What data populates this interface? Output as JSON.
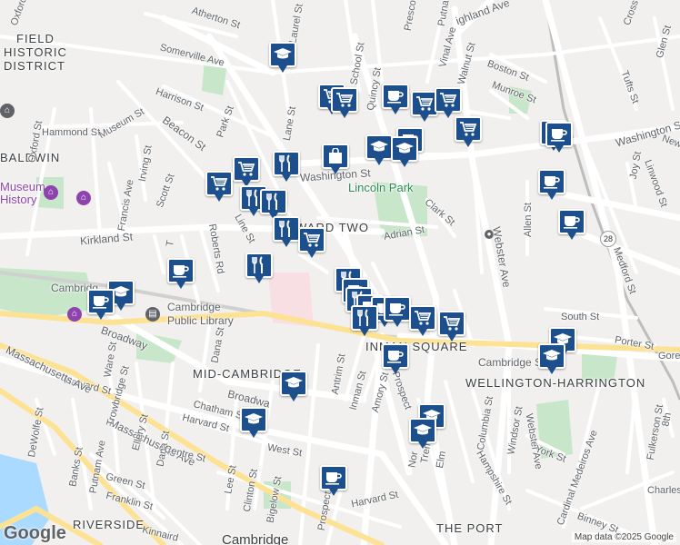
{
  "map": {
    "attribution": "Map data ©2025 Google",
    "logo": "Google",
    "areas": {
      "field": "FIELD",
      "historic": "HISTORIC",
      "district": "DISTRICT",
      "baldwin": "BALDWIN",
      "ward_two": "WARD TWO",
      "inman_square": "INMAN SQUARE",
      "mid_cambridge": "MID-CAMBRIDGE",
      "wellington_harrington": "WELLINGTON-HARRINGTON",
      "riverside": "RIVERSIDE",
      "the_port": "THE PORT",
      "cambridge": "Cambridge"
    },
    "pois": {
      "lincoln_park": "Lincoln Park",
      "museum": "Museum",
      "history": "History",
      "library_1": "Cambridge",
      "library_2": "Public Library"
    },
    "streets": {
      "somerville_ave": "Somerville Ave",
      "atherton_st": "Atherton St",
      "washington_st": "Washington St",
      "washington_st_east": "Washington St",
      "kirkland_st": "Kirkland St",
      "cambridge_st": "Cambridge St",
      "cambridge_st_west": "Cambridg",
      "broadway": "Broadway",
      "broadway_mid": "Broadwa",
      "harvard_st": "Harvard St",
      "harvard_st_2": "Harvard St",
      "harvard_st_3": "Harvard St",
      "massachusetts_ave": "Massachusetts Ave",
      "massachusetts_ave_2": "Massachusetts Ave",
      "beacon_st": "Beacon St",
      "hammond_st": "Hammond St",
      "museum_st": "Museum St",
      "harrison_st": "Harrison St",
      "park_st": "Park St",
      "oxford_st": "Oxford St",
      "oxford_st_2": "Oxford St",
      "francis_ave": "Francis Ave",
      "irving_st": "Irving St",
      "scott_st": "Scott St",
      "line_st": "Line St",
      "adrian_st": "Adrian St",
      "clark_st": "Clark St",
      "webster_ave": "Webster Ave",
      "webster_ave_2": "Webster Ave",
      "allen_st": "Allen St",
      "medford_st": "Medford St",
      "linwood_st": "Linwood St",
      "joy_st": "Joy St",
      "tufts_st": "Tufts St",
      "glen_st": "Glen St",
      "boston_st": "Boston St",
      "munroe_st": "Munroe St",
      "walnut_st": "Walnut St",
      "vinal_ave": "Vinal Ave",
      "putnam_ave": "Putnam",
      "putnam_ave_2": "Putnam Ave",
      "highland_ave": "ighland Ave",
      "prescott_st": "Prescott",
      "quincy_st": "Quincy St",
      "school_st": "School St",
      "laurel_st": "Laurel St",
      "lane_st": "Lane St",
      "south_st": "South St",
      "porter_st": "Porter St",
      "gore_st": "Gore",
      "york_st": "York St",
      "windsor_st": "Windsor St",
      "columbia_st": "Columbia St",
      "hampshire_st": "Hampshire St",
      "amory_st": "Amory St",
      "inman_st": "Inman St",
      "antrim_st": "Antrim St",
      "prospect_st": "Prospect",
      "prospect_st_2": "Prospect St",
      "tremont_st": "Tremont",
      "elm_st": "Elm",
      "norfolk_st": "Nor",
      "dana_st": "Dana St",
      "dana_st_2": "Dana St",
      "chatham_st": "Chatham St",
      "centre_st": "Centre St",
      "west_st": "West St",
      "ellery_st": "Ellery St",
      "trowbridge_st": "Trowbridge St",
      "ware_st": "Ware St",
      "banks_st": "Banks St",
      "dewolfe_st": "DeWolfe St",
      "green_st": "Green St",
      "franklin_st": "Franklin St",
      "kinnaird_st": "Kinnaird",
      "lee_st": "Lee St",
      "clinton_st": "Clinton St",
      "bigelow_st": "Bigelow St",
      "fulkerson_st": "Fulkerson St",
      "charles_st": "Charles",
      "binney_st": "Binney St",
      "cardinal_medeiros": "Cardinal Medeiros Ave",
      "eighth_st": "8th",
      "new_st": "New",
      "crossst": "Cross",
      "robert_rd": "Roberts Rd",
      "t_st": "T"
    },
    "route_shield": "28",
    "colors": {
      "marker": "#1d4f8c",
      "park": "#c8e6c9",
      "water": "#aadaff",
      "road": "#ffffff",
      "major_road": "#fde293"
    },
    "marker_types": [
      "shopping-cart",
      "restaurant",
      "cafe",
      "school",
      "shopping-bag"
    ]
  }
}
